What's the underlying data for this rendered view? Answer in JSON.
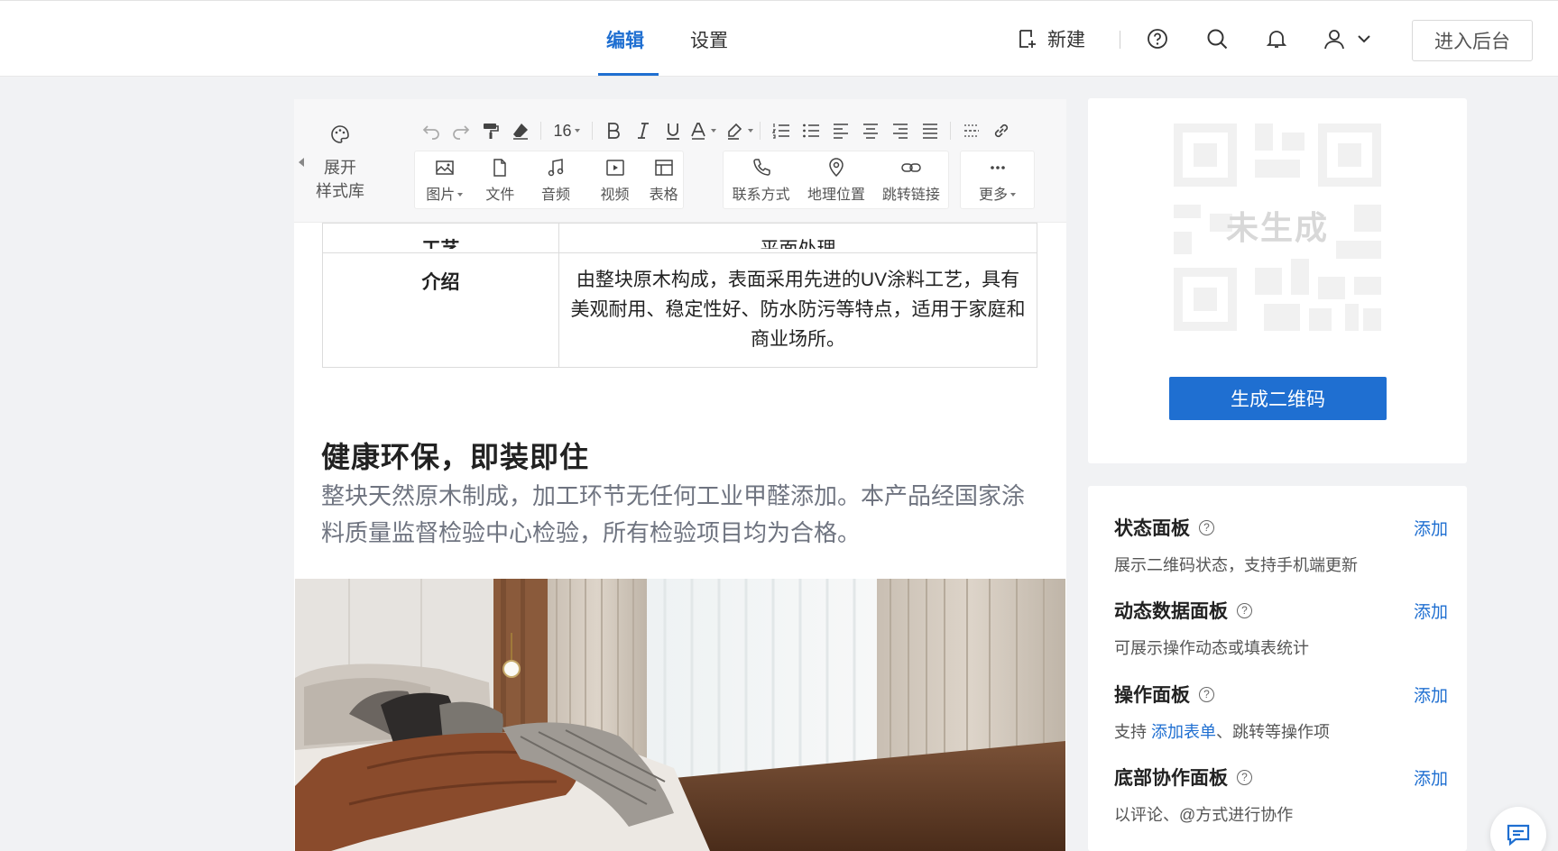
{
  "header": {
    "tabs": [
      {
        "label": "编辑",
        "active": true
      },
      {
        "label": "设置",
        "active": false
      }
    ],
    "new_label": "新建",
    "backend_label": "进入后台",
    "accent_color": "#1f6fd1"
  },
  "toolbar": {
    "style_lib_line1": "展开",
    "style_lib_line2": "样式库",
    "font_size": "16",
    "insert_items": {
      "image": "图片",
      "file": "文件",
      "audio": "音频",
      "video": "视频",
      "table": "表格",
      "contact": "联系方式",
      "location": "地理位置",
      "jump_link": "跳转链接",
      "more": "更多"
    }
  },
  "document": {
    "table": {
      "cut_row": {
        "head": "工艺",
        "body": "平面处理"
      },
      "intro_row": {
        "head": "介绍",
        "body": "由整块原木构成，表面采用先进的UV涂料工艺，具有美观耐用、稳定性好、防水防污等特点，适用于家庭和商业场所。"
      }
    },
    "section_title": "健康环保，即装即住",
    "section_text": "整块天然原木制成，加工环节无任何工业甲醛添加。本产品经国家涂料质量监督检验中心检验，所有检验项目均为合格。"
  },
  "qr": {
    "status_text": "未生成",
    "generate_label": "生成二维码"
  },
  "panels": [
    {
      "title": "状态面板",
      "desc": "展示二维码状态，支持手机端更新",
      "action": "添加"
    },
    {
      "title": "动态数据面板",
      "desc": "可展示操作动态或填表统计",
      "action": "添加"
    },
    {
      "title": "操作面板",
      "desc_prefix": "支持 ",
      "desc_link": "添加表单",
      "desc_suffix": "、跳转等操作项",
      "action": "添加"
    },
    {
      "title": "底部协作面板",
      "desc": "以评论、@方式进行协作",
      "action": "添加"
    }
  ]
}
